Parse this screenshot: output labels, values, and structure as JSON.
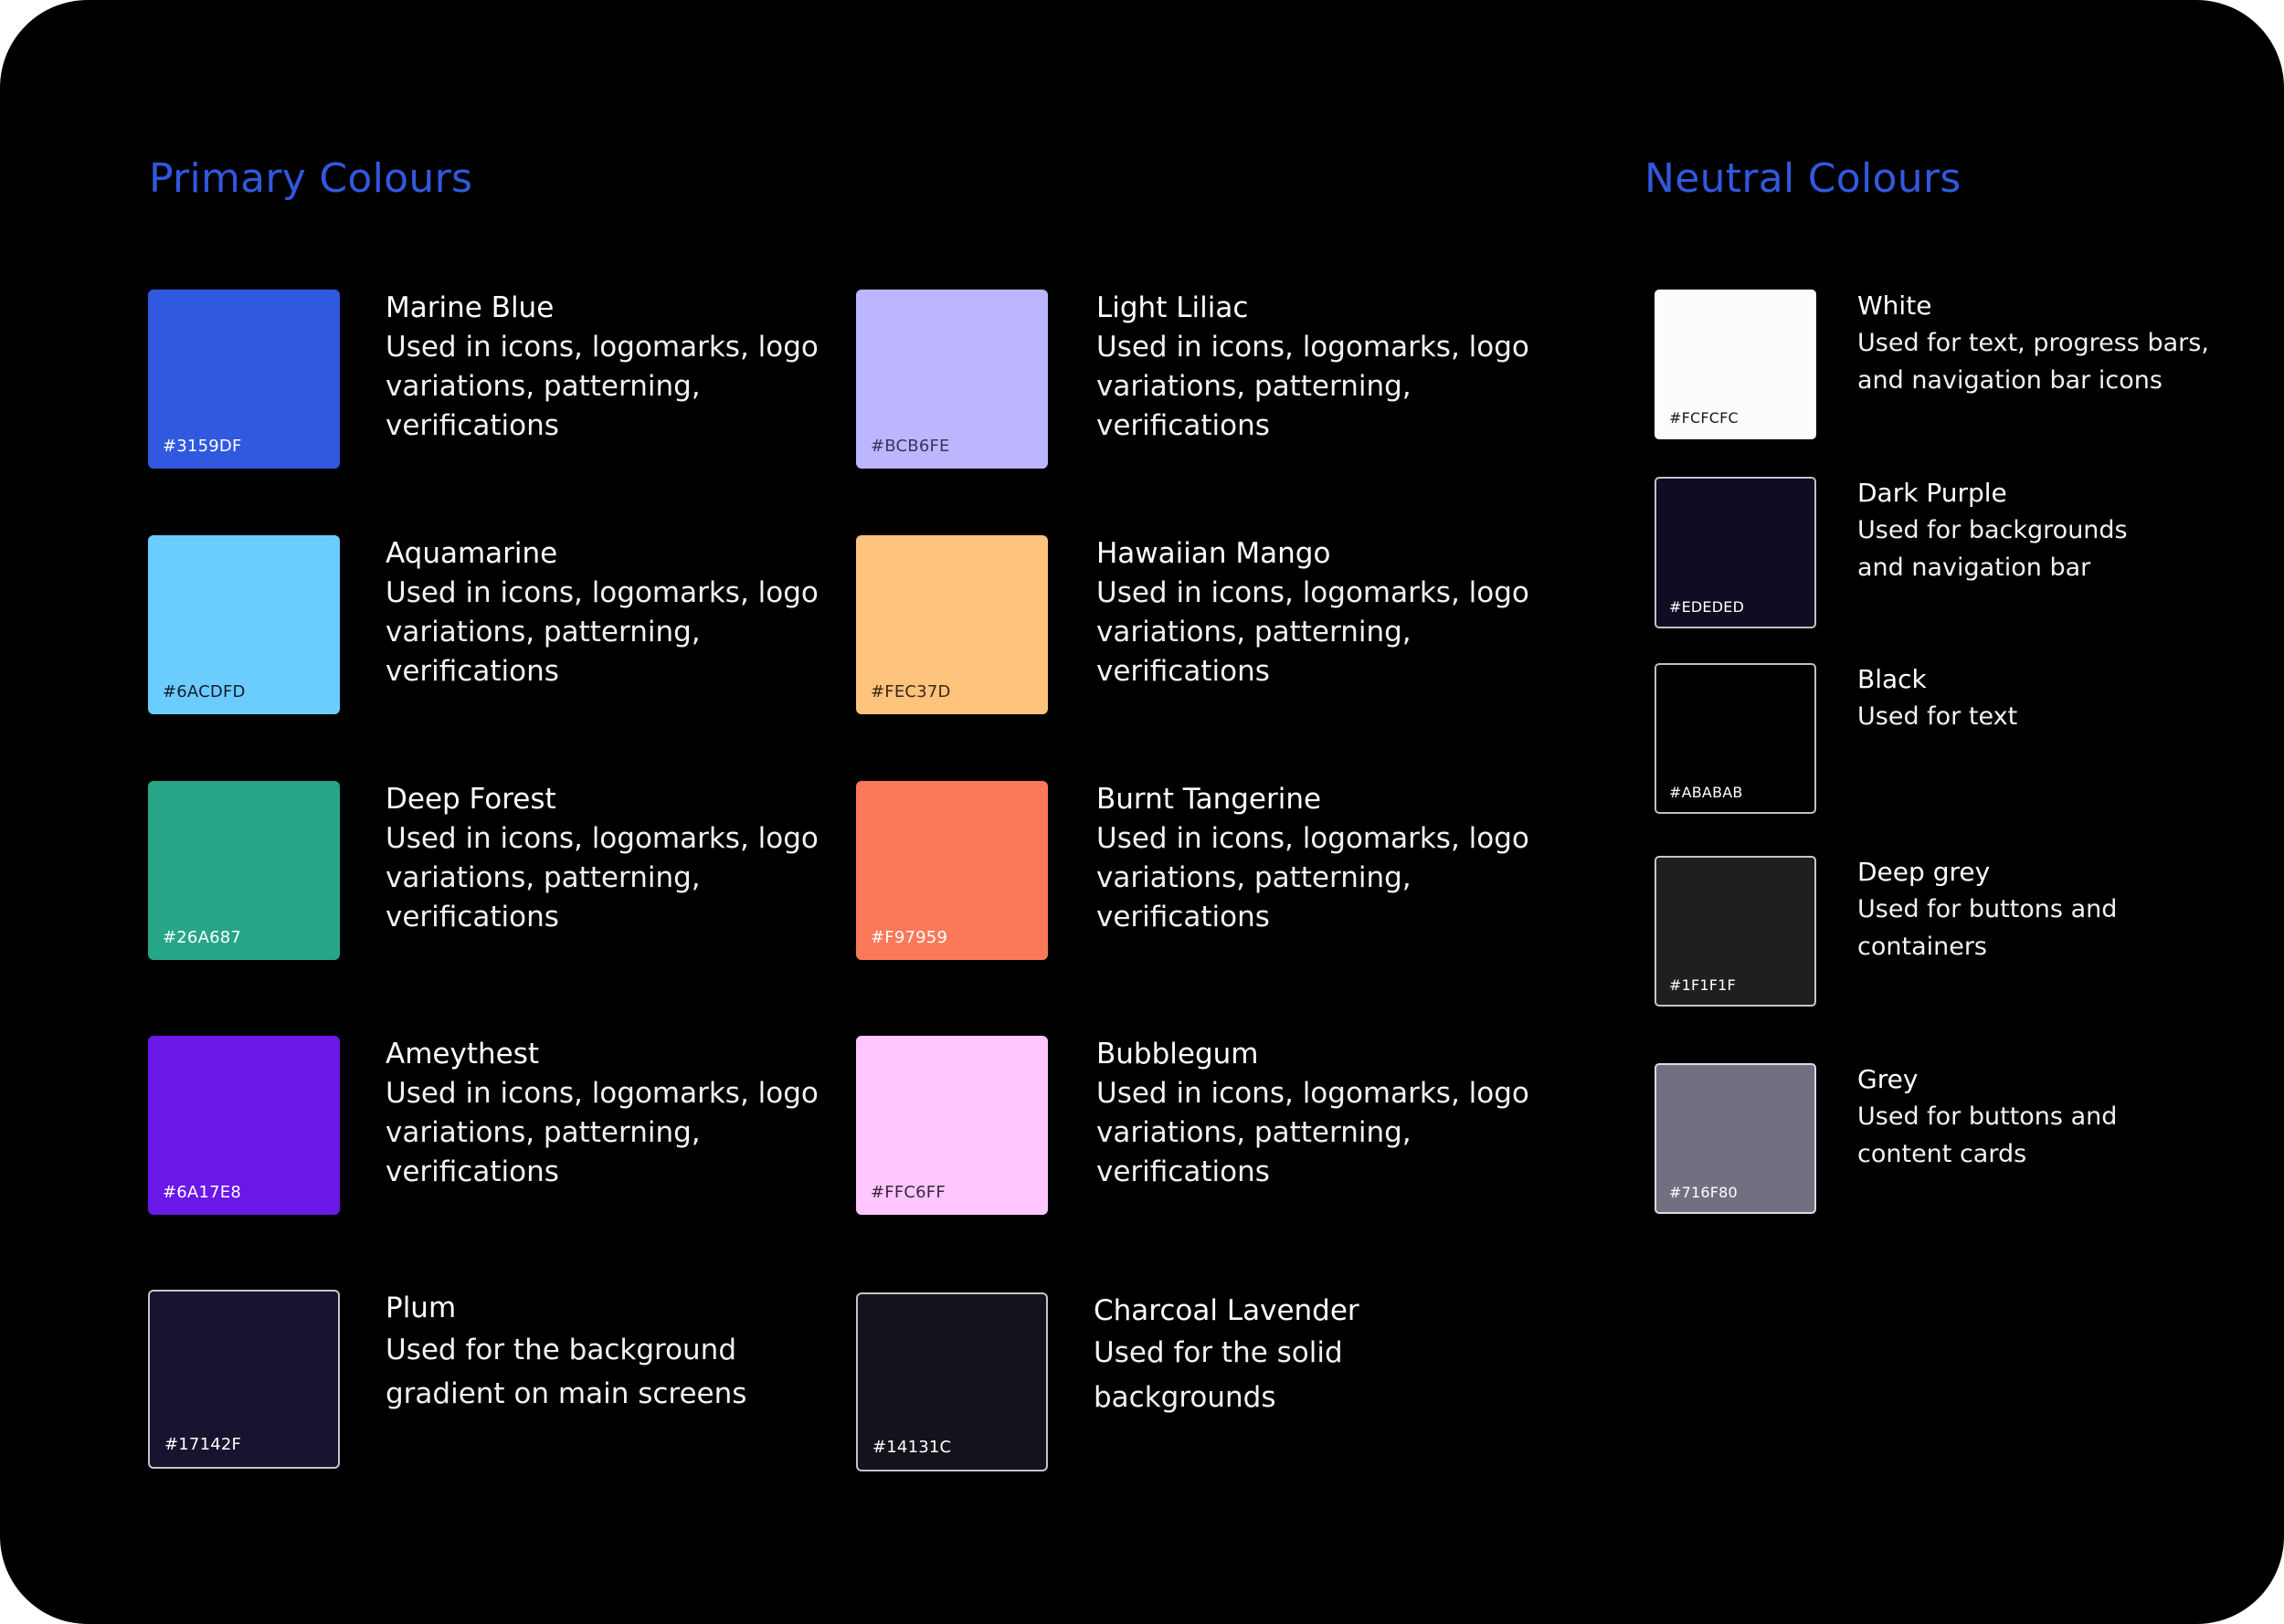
{
  "colors": {
    "accent": "#3159DF",
    "background": "#000000",
    "text": "#FFFFFF"
  },
  "primary": {
    "title": "Primary Colours",
    "items": [
      {
        "name": "Marine Blue",
        "hex": "#3159DF",
        "color": "#3159DF",
        "desc": "Used in icons, logomarks, logo\nvariations, patterning,\nverifications",
        "hex_color": "#FFFFFF",
        "bordered": false
      },
      {
        "name": "Aquamarine",
        "hex": "#6ACDFD",
        "color": "#6ACDFD",
        "desc": "Used in icons, logomarks, logo\nvariations, patterning,\nverifications",
        "hex_color": "#1a1a2e",
        "bordered": false
      },
      {
        "name": "Deep Forest",
        "hex": "#26A687",
        "color": "#26A687",
        "desc": "Used in icons, logomarks, logo\nvariations, patterning,\nverifications",
        "hex_color": "#FFFFFF",
        "bordered": false
      },
      {
        "name": "Ameythest",
        "hex": "#6A17E8",
        "color": "#6A17E8",
        "desc": "Used in icons, logomarks, logo\nvariations, patterning,\nverifications",
        "hex_color": "#FFFFFF",
        "bordered": false
      },
      {
        "name": "Plum",
        "hex": "#17142F",
        "color": "#17142F",
        "desc": "Used for the background\ngradient on main screens",
        "hex_color": "#FFFFFF",
        "bordered": true
      },
      {
        "name": "Light Liliac",
        "hex": "#BCB6FE",
        "color": "#BCB6FE",
        "desc": "Used in icons, logomarks, logo\nvariations, patterning,\nverifications",
        "hex_color": "#3a3560",
        "bordered": false
      },
      {
        "name": "Hawaiian Mango",
        "hex": "#FEC37D",
        "color": "#FEC37D",
        "desc": "Used in icons, logomarks, logo\nvariations, patterning,\nverifications",
        "hex_color": "#3a2a10",
        "bordered": false
      },
      {
        "name": "Burnt Tangerine",
        "hex": "#F97959",
        "color": "#F97959",
        "desc": "Used in icons, logomarks, logo\nvariations, patterning,\nverifications",
        "hex_color": "#FFFFFF",
        "bordered": false
      },
      {
        "name": "Bubblegum",
        "hex": "#FFC6FF",
        "color": "#FFC6FF",
        "desc": "Used in icons, logomarks, logo\nvariations, patterning,\nverifications",
        "hex_color": "#3a2a3a",
        "bordered": false
      },
      {
        "name": "Charcoal Lavender",
        "hex": "#14131C",
        "color": "#14131C",
        "desc": "Used for the solid\nbackgrounds",
        "hex_color": "#FFFFFF",
        "bordered": true
      }
    ]
  },
  "neutral": {
    "title": "Neutral Colours",
    "items": [
      {
        "name": "White",
        "hex": "#FCFCFC",
        "color": "#FCFCFC",
        "desc": "Used for text, progress bars,\nand navigation bar icons",
        "hex_color": "#1a1a1a",
        "bordered": true
      },
      {
        "name": "Dark Purple",
        "hex": "#EDEDED",
        "color": "#0F0D24",
        "desc": "Used for backgrounds\nand navigation bar",
        "hex_color": "#FFFFFF",
        "bordered": true
      },
      {
        "name": "Black",
        "hex": "#ABABAB",
        "color": "#000000",
        "desc": "Used for text",
        "hex_color": "#FFFFFF",
        "bordered": true
      },
      {
        "name": "Deep grey",
        "hex": "#1F1F1F",
        "color": "#1F1F1F",
        "desc": "Used for buttons and\ncontainers",
        "hex_color": "#FFFFFF",
        "bordered": true
      },
      {
        "name": "Grey",
        "hex": "#716F80",
        "color": "#716F80",
        "desc": "Used for buttons and\ncontent cards",
        "hex_color": "#FFFFFF",
        "bordered": true
      }
    ]
  }
}
